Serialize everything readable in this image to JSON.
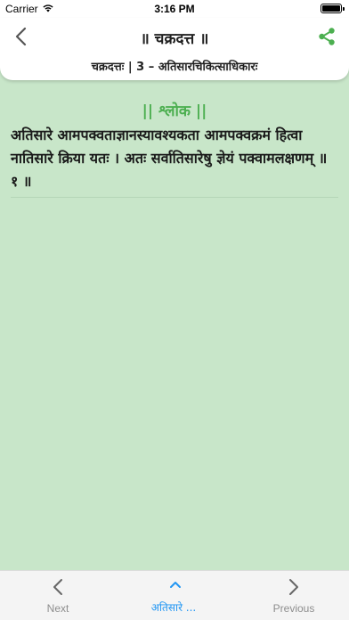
{
  "status_bar": {
    "carrier": "Carrier",
    "time": "3:16 PM"
  },
  "header": {
    "title": "॥ चक्रदत्त ॥",
    "breadcrumb": "चक्रदत्तः | 3 – अतिसारचिकित्साधिकारः"
  },
  "content": {
    "heading": "|| श्लोक ||",
    "verse": "अतिसारे आमपक्वताज्ञानस्यावश्यकता आमपक्वक्रमं हित्वा नातिसारे क्रिया यतः । अतः सर्वातिसारेषु ज्ञेयं पक्वामलक्षणम् ॥ १ ॥"
  },
  "bottom_nav": {
    "next_label": "Next",
    "center_label": "अतिसारे ...",
    "previous_label": "Previous"
  },
  "colors": {
    "background": "#c8e6c9",
    "accent_green": "#4caf50",
    "link_blue": "#2196f3"
  }
}
